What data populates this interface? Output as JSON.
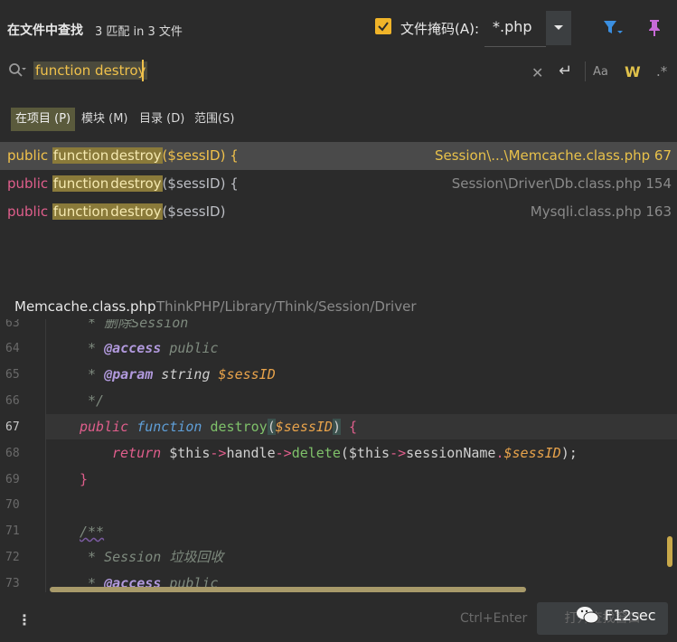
{
  "header": {
    "title": "在文件中查找",
    "match_info": "3 匹配 in 3 文件",
    "file_mask_label": "文件掩码(A):",
    "file_mask_value": "*.php"
  },
  "search": {
    "query": "function destroy"
  },
  "scope_tabs": [
    {
      "label": "在项目 (P)",
      "selected": true
    },
    {
      "label": "模块 (M)",
      "selected": false
    },
    {
      "label": "目录 (D)",
      "selected": false
    },
    {
      "label": "范围(S)",
      "selected": false
    }
  ],
  "results": [
    {
      "pre": "public",
      "m1": "function",
      "m2": "destroy",
      "rest": "($sessID) {",
      "file": "Session\\...\\Memcache.class.php 67"
    },
    {
      "pre": "public",
      "m1": "function",
      "m2": "destroy",
      "rest": "($sessID) {",
      "file": "Session\\Driver\\Db.class.php 154"
    },
    {
      "pre": "public",
      "m1": "function",
      "m2": "destroy",
      "rest": "($sessID)",
      "file": "Mysqli.class.php 163"
    }
  ],
  "preview": {
    "file": "Memcache.class.php",
    "path": "ThinkPHP/Library/Think/Session/Driver"
  },
  "code": {
    "line_numbers": [
      "63",
      "64",
      "65",
      "66",
      "67",
      "68",
      "69",
      "70",
      "71",
      "72",
      "73"
    ],
    "current_line": "67",
    "l63": " * 删除Session",
    "l64_star": " * ",
    "l64_tag": "@access",
    "l64_val": " public",
    "l65_star": " * ",
    "l65_tag": "@param",
    "l65_type": " string ",
    "l65_var": "$sessID",
    "l66": " */",
    "l67_pub": "public ",
    "l67_fnk": "function ",
    "l67_name": "destroy",
    "l67_open": "(",
    "l67_var": "$sessID",
    "l67_close": ")",
    "l67_brace": " {",
    "l68_ret": "return ",
    "l68_this1": "$this",
    "l68_arrow1": "->",
    "l68_handle": "handle",
    "l68_arrow2": "->",
    "l68_delete": "delete",
    "l68_open": "(",
    "l68_this2": "$this",
    "l68_arrow3": "->",
    "l68_sname": "sessionName",
    "l68_dot": ".",
    "l68_var": "$sessID",
    "l68_close": ");",
    "l69": "}",
    "l71": "/**",
    "l72": " * Session 垃圾回收",
    "l73_star": " * ",
    "l73_tag": "@access",
    "l73_val": " public"
  },
  "footer": {
    "shortcut": "Ctrl+Enter",
    "open_button": "打开查找窗口",
    "watermark": "F12sec"
  },
  "colors": {
    "accent": "#f0c14b",
    "keyword": "#e05e8c",
    "function_name": "#7fc16a"
  }
}
